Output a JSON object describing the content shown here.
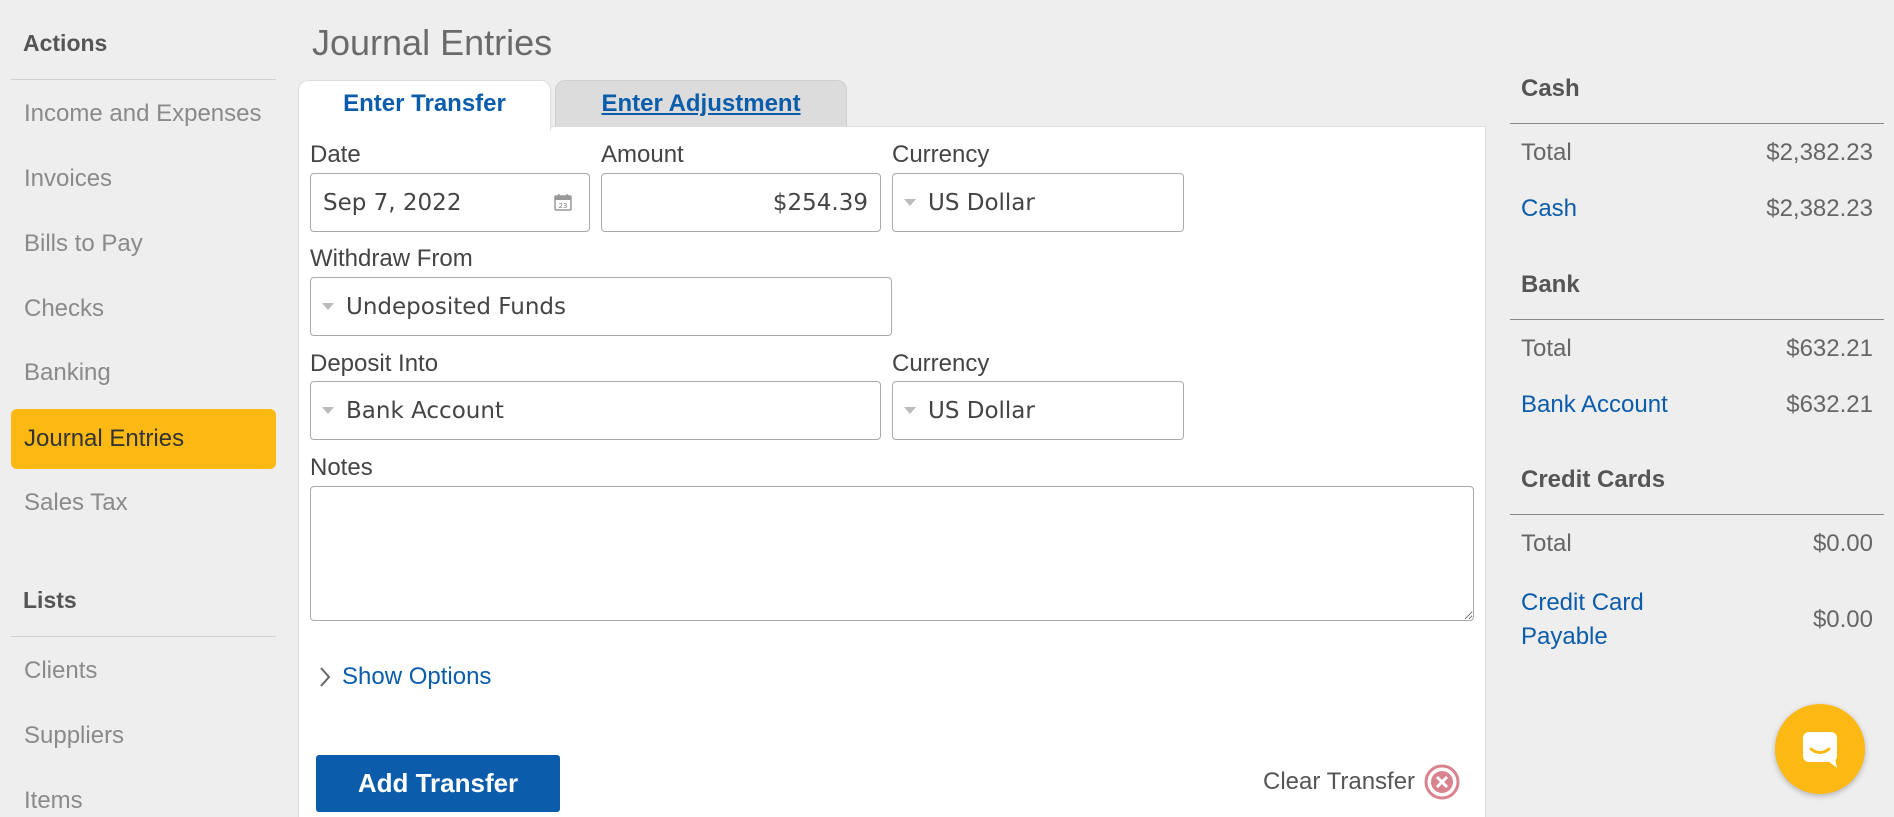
{
  "sidebar": {
    "actions_heading": "Actions",
    "action_items": [
      {
        "label": "Income and Expenses"
      },
      {
        "label": "Invoices"
      },
      {
        "label": "Bills to Pay"
      },
      {
        "label": "Checks"
      },
      {
        "label": "Banking"
      },
      {
        "label": "Journal Entries",
        "active": true
      },
      {
        "label": "Sales Tax"
      }
    ],
    "lists_heading": "Lists",
    "list_items": [
      {
        "label": "Clients"
      },
      {
        "label": "Suppliers"
      },
      {
        "label": "Items"
      }
    ]
  },
  "main": {
    "title": "Journal Entries",
    "tabs": [
      {
        "label": "Enter Transfer",
        "active": true
      },
      {
        "label": "Enter Adjustment",
        "active": false
      }
    ],
    "form": {
      "date_label": "Date",
      "date_value": "Sep 7, 2022",
      "amount_label": "Amount",
      "amount_value": "$254.39",
      "currency_label": "Currency",
      "currency_value": "US Dollar",
      "withdraw_label": "Withdraw From",
      "withdraw_value": "Undeposited Funds",
      "deposit_label": "Deposit Into",
      "deposit_value": "Bank Account",
      "deposit_currency_label": "Currency",
      "deposit_currency_value": "US Dollar",
      "notes_label": "Notes",
      "notes_value": "",
      "show_options": "Show Options",
      "add_button": "Add Transfer",
      "clear_button": "Clear Transfer"
    }
  },
  "balances": {
    "cash": {
      "heading": "Cash",
      "total_label": "Total",
      "total_value": "$2,382.23",
      "accounts": [
        {
          "name": "Cash",
          "value": "$2,382.23"
        }
      ]
    },
    "bank": {
      "heading": "Bank",
      "total_label": "Total",
      "total_value": "$632.21",
      "accounts": [
        {
          "name": "Bank Account",
          "value": "$632.21"
        }
      ]
    },
    "credit_cards": {
      "heading": "Credit Cards",
      "total_label": "Total",
      "total_value": "$0.00",
      "accounts": [
        {
          "name_line1": "Credit Card",
          "name_line2": "Payable",
          "value": "$0.00"
        }
      ]
    }
  },
  "colors": {
    "accent_yellow": "#fdb913",
    "link_blue": "#0b5cab",
    "clear_icon": "#d9838f"
  },
  "icons": {
    "calendar": "calendar-icon",
    "caret": "caret-down-icon",
    "chevron": "chevron-right-icon",
    "clear": "close-circle-icon",
    "chat": "chat-icon"
  }
}
